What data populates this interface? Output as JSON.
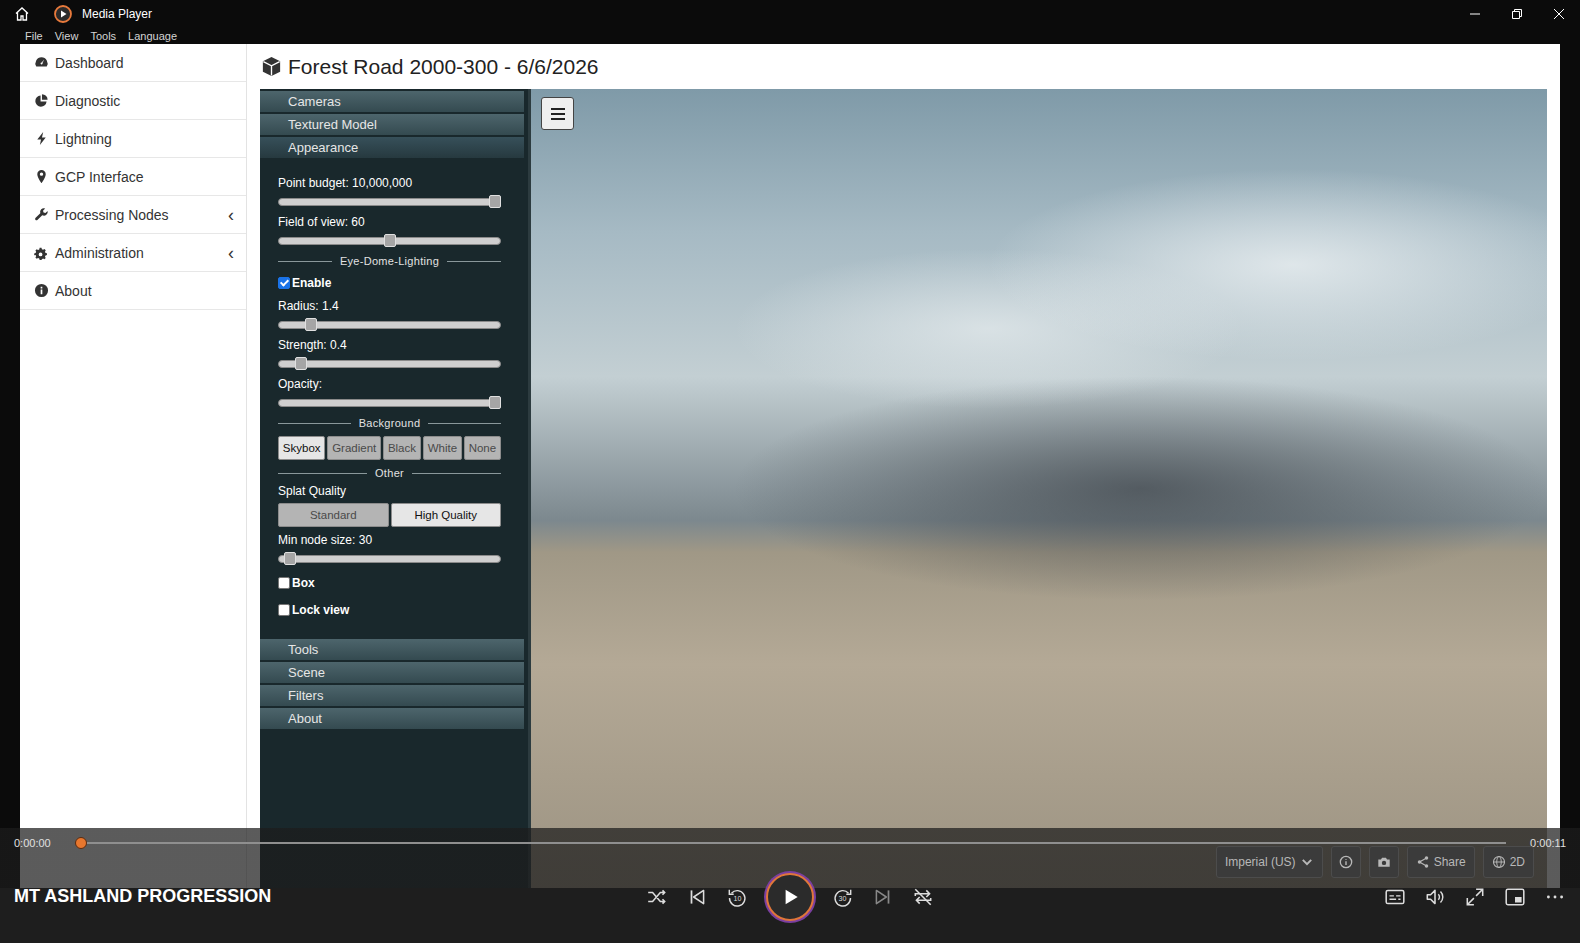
{
  "window": {
    "title": "Media Player",
    "menu": [
      "File",
      "View",
      "Tools",
      "Language"
    ]
  },
  "sidebar": {
    "items": [
      {
        "label": "Dashboard"
      },
      {
        "label": "Diagnostic"
      },
      {
        "label": "Lightning"
      },
      {
        "label": "GCP Interface"
      },
      {
        "label": "Processing Nodes",
        "expander": "‹"
      },
      {
        "label": "Administration",
        "expander": "‹"
      },
      {
        "label": "About"
      }
    ]
  },
  "page": {
    "title": "Forest Road 2000-300 - 6/6/2026"
  },
  "panel": {
    "sections_top": [
      {
        "label": "Cameras",
        "expanded": false
      },
      {
        "label": "Textured Model",
        "expanded": false
      },
      {
        "label": "Appearance",
        "expanded": true
      }
    ],
    "controls": [
      {
        "kind": "slider",
        "label": "Point budget: 10,000,000",
        "level": 1.0
      },
      {
        "kind": "slider",
        "label": "Field of view: 60",
        "level": 0.5
      },
      {
        "kind": "divider",
        "label": "Eye-Dome-Lighting"
      },
      {
        "kind": "checkbox",
        "label": "Enable",
        "checked": true
      },
      {
        "kind": "slider",
        "label": "Radius: 1.4",
        "level": 0.13
      },
      {
        "kind": "slider",
        "label": "Strength: 0.4",
        "level": 0.08
      },
      {
        "kind": "slider",
        "label": "Opacity:",
        "level": 1.0
      },
      {
        "kind": "divider",
        "label": "Background"
      },
      {
        "kind": "buttons",
        "fill": false,
        "options": [
          {
            "label": "Skybox",
            "selected": true
          },
          {
            "label": "Gradient",
            "selected": false
          },
          {
            "label": "Black",
            "selected": false
          },
          {
            "label": "White",
            "selected": false
          },
          {
            "label": "None",
            "selected": false
          }
        ]
      },
      {
        "kind": "divider",
        "label": "Other"
      },
      {
        "kind": "label",
        "label": "Splat Quality"
      },
      {
        "kind": "buttons",
        "fill": true,
        "options": [
          {
            "label": "Standard",
            "selected": false
          },
          {
            "label": "High Quality",
            "selected": true
          }
        ]
      },
      {
        "kind": "slider",
        "label": "Min node size: 30",
        "level": 0.03
      },
      {
        "kind": "checkbox",
        "label": "Box",
        "checked": false
      },
      {
        "kind": "checkbox",
        "label": "Lock view",
        "checked": false
      }
    ],
    "sections_bottom": [
      {
        "label": "Tools",
        "expanded": false
      },
      {
        "label": "Scene",
        "expanded": false
      },
      {
        "label": "Filters",
        "expanded": false
      },
      {
        "label": "About",
        "expanded": false
      }
    ]
  },
  "viewer_controls": {
    "units": "Imperial (US)",
    "share": "Share",
    "mode": "2D"
  },
  "player": {
    "title": "MT ASHLAND PROGRESSION",
    "elapsed": "0:00:00",
    "duration": "0:00:11",
    "level": 0,
    "playing": false,
    "repeat": false,
    "skip_back": "10",
    "skip_forward": "30"
  }
}
